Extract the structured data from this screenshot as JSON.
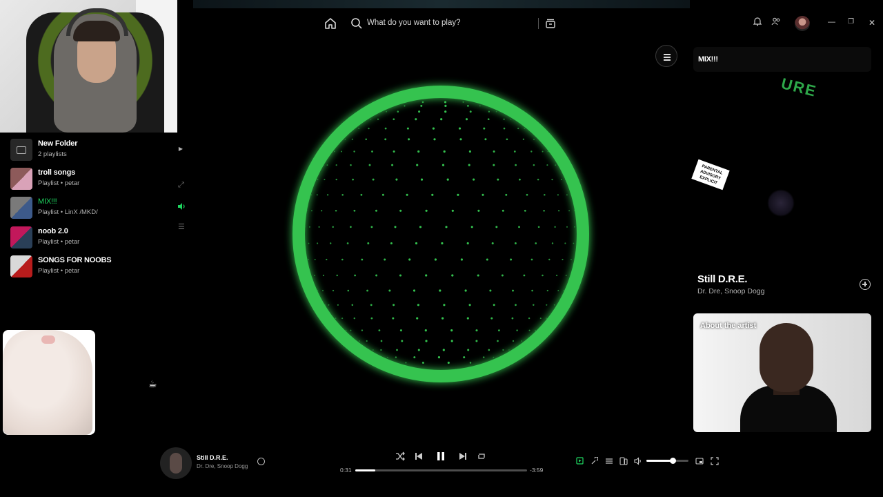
{
  "search": {
    "placeholder": "What do you want to play?"
  },
  "library": {
    "items": [
      {
        "title": "New Folder",
        "subtitle": "2 playlists",
        "type": "folder"
      },
      {
        "title": "troll songs",
        "subtitle": "Playlist • petar",
        "type": "playlist"
      },
      {
        "title": "MIX!!!",
        "subtitle": "Playlist • LinX /MKD/",
        "type": "playlist",
        "active": true
      },
      {
        "title": "noob 2.0",
        "subtitle": "Playlist • petar",
        "type": "playlist"
      },
      {
        "title": "SONGS FOR NOOBS",
        "subtitle": "Playlist • petar",
        "type": "playlist"
      }
    ]
  },
  "right_panel": {
    "playlist_title": "MIX!!!",
    "track_title": "Still D.R.E.",
    "track_artists": "Dr. Dre, Snoop Dogg",
    "about_label": "About the artist"
  },
  "player": {
    "title": "Still D.R.E.",
    "artists": "Dr. Dre, Snoop Dogg",
    "elapsed": "0:31",
    "remaining": "-3:59",
    "progress": 0.115,
    "volume": 0.62
  },
  "colors": {
    "accent": "#1ed760",
    "sphere": "#34c34f",
    "background": "#000000"
  },
  "icons": {
    "home": "home-icon",
    "search": "search-icon",
    "browse": "browse-icon",
    "notifications": "bell-icon",
    "friends": "friends-icon"
  }
}
